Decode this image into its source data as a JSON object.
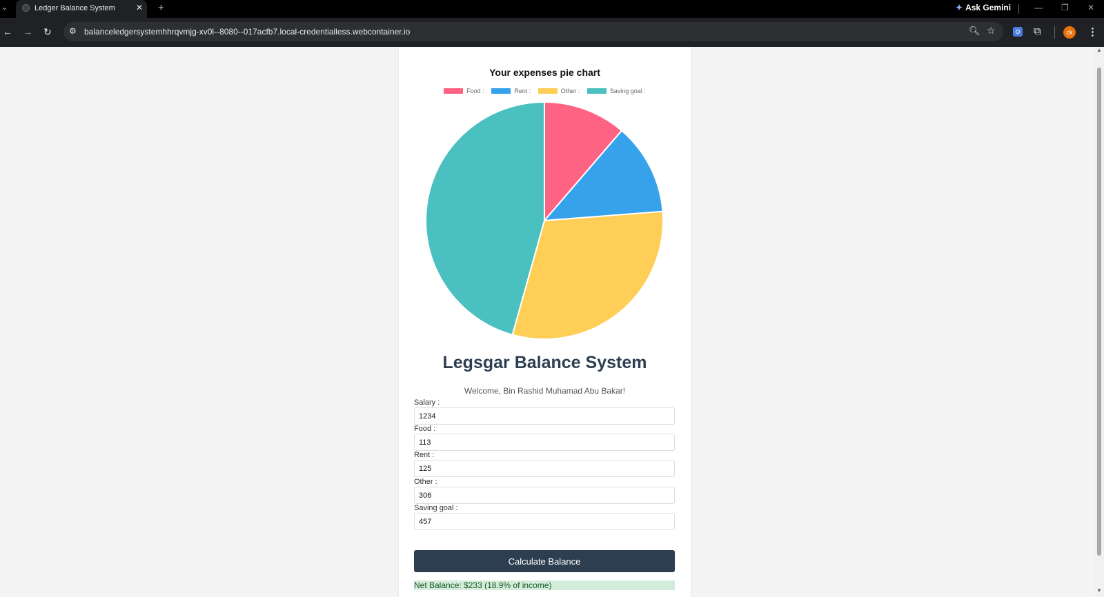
{
  "browser": {
    "tab_title": "Ledger Balance System",
    "url": "balanceledgersystemhhrqvmjg-xv0l--8080--017acfb7.local-credentialless.webcontainer.io",
    "gemini_label": "Ask Gemini",
    "profile_initials": "ck"
  },
  "chart": {
    "title": "Your expenses pie chart",
    "legend": [
      "Food :",
      "Rent :",
      "Other :",
      "Saving goal :"
    ]
  },
  "chart_data": {
    "type": "pie",
    "title": "Your expenses pie chart",
    "categories": [
      "Food :",
      "Rent :",
      "Other :",
      "Saving goal :"
    ],
    "values": [
      113,
      125,
      306,
      457
    ],
    "colors": [
      "#ff6384",
      "#36a2eb",
      "#ffce56",
      "#4bc0c0"
    ],
    "legend_position": "top"
  },
  "app": {
    "title": "Legsgar Balance System",
    "welcome": "Welcome, Bin Rashid Muhamad Abu Bakar!",
    "fields": [
      {
        "label": "Salary :",
        "value": "1234"
      },
      {
        "label": "Food :",
        "value": "113"
      },
      {
        "label": "Rent :",
        "value": "125"
      },
      {
        "label": "Other :",
        "value": "306"
      },
      {
        "label": "Saving goal :",
        "value": "457"
      }
    ],
    "button_label": "Calculate Balance",
    "result_text": "Net Balance: $233 (18.9% of income)"
  }
}
